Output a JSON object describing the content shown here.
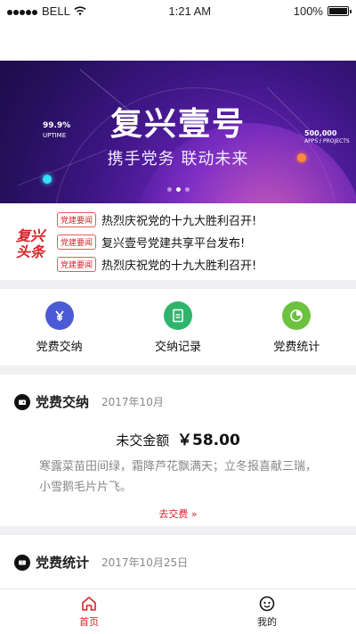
{
  "status_bar": {
    "carrier": "BELL",
    "time": "1:21 AM",
    "battery": "100%"
  },
  "banner": {
    "title": "复兴壹号",
    "subtitle": "携手党务 联动未来",
    "stat_left_value": "99.9",
    "stat_left_unit": "%",
    "stat_left_label": "UPTIME",
    "stat_right_value": "500,000",
    "stat_right_label": "APPS / PROJECTS",
    "pager_count": 3,
    "pager_active": 1
  },
  "news": {
    "logo_line1": "复兴",
    "logo_line2": "头条",
    "items": [
      {
        "tag": "党建要闻",
        "text": "热烈庆祝党的十九大胜利召开!"
      },
      {
        "tag": "党建要闻",
        "text": "复兴壹号党建共享平台发布!"
      },
      {
        "tag": "党建要闻",
        "text": "热烈庆祝党的十九大胜利召开!"
      }
    ]
  },
  "actions": [
    {
      "label": "党费交纳",
      "icon": "yen-icon",
      "color": "#4b5bd6"
    },
    {
      "label": "交纳记录",
      "icon": "document-icon",
      "color": "#2fb46c"
    },
    {
      "label": "党费统计",
      "icon": "pie-chart-icon",
      "color": "#6cc23e"
    }
  ],
  "fee_card": {
    "title": "党费交纳",
    "date": "2017年10月",
    "amount_label": "未交金额",
    "amount_value": "￥58.00",
    "poem": "寒露菜苗田间绿，霜降芦花飘满天；立冬报喜献三瑞，小雪鹅毛片片飞。",
    "pay_link": "去交费 »"
  },
  "stats_card": {
    "title": "党费统计",
    "date": "2017年10月25日"
  },
  "tabbar": [
    {
      "label": "首页",
      "icon": "home-icon",
      "active": true
    },
    {
      "label": "我的",
      "icon": "profile-icon",
      "active": false
    }
  ],
  "colors": {
    "accent_red": "#d8232a",
    "banner_purple": "#5a1fa8"
  }
}
